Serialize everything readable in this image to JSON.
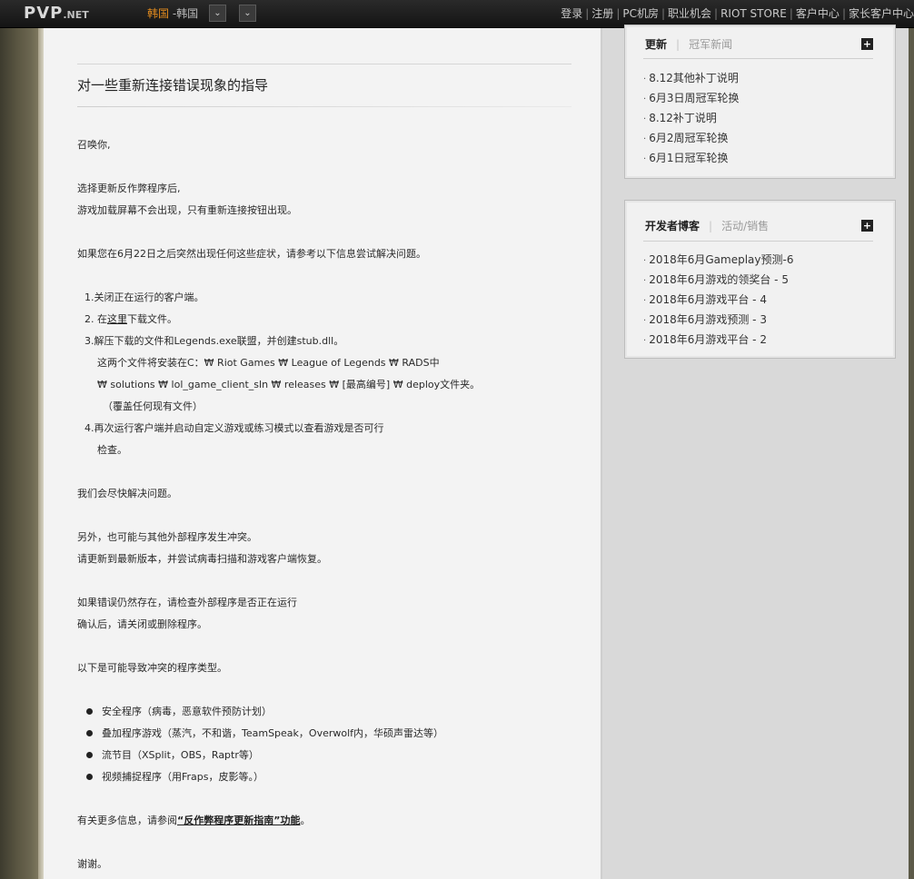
{
  "topbar": {
    "logo_main": "PVP",
    "logo_suffix": ".NET",
    "region_primary": "韩国",
    "region_secondary": "-韩国",
    "dropdown_glyph": "⌄",
    "nav": [
      "登录",
      "注册",
      "PC机房",
      "职业机会",
      "RIOT STORE",
      "客户中心",
      "家长客户中心"
    ],
    "nav_separator": "|"
  },
  "article": {
    "title": "对一些重新连接错误现象的指导",
    "lines": {
      "greeting": "召唤你,",
      "p1a": "选择更新反作弊程序后,",
      "p1b": "游戏加载屏幕不会出现，只有重新连接按钮出现。",
      "p2": "如果您在6月22日之后突然出现任何这些症状，请参考以下信息尝试解决问题。",
      "s1": "1.关闭正在运行的客户端。",
      "s2_pre": "2. 在",
      "s2_link": "这里",
      "s2_post": "下载文件。",
      "s3": "3.解压下载的文件和Legends.exe联盟，并创建stub.dll。",
      "s3b": "这两个文件将安装在C：₩ Riot Games ₩ League of Legends ₩ RADS中",
      "s3c": "₩ solutions ₩ lol_game_client_sln ₩ releases ₩ [最高编号] ₩ deploy文件夹。",
      "s3d": "（覆盖任何现有文件）",
      "s4": "4.再次运行客户端并启动自定义游戏或练习模式以查看游戏是否可行",
      "s4b": "检查。",
      "p3": "我们会尽快解决问题。",
      "p4a": "另外，也可能与其他外部程序发生冲突。",
      "p4b": "请更新到最新版本，并尝试病毒扫描和游戏客户端恢复。",
      "p5a": "如果错误仍然存在，请检查外部程序是否正在运行",
      "p5b": "确认后，请关闭或删除程序。",
      "p6": "以下是可能导致冲突的程序类型。",
      "b1": "安全程序（病毒，恶意软件预防计划）",
      "b2": "叠加程序游戏（蒸汽，不和谐，TeamSpeak，Overwolf内，华硕声雷达等）",
      "b3": "流节目（XSplit，OBS，Raptr等）",
      "b4": "视频捕捉程序（用Fraps，皮影等。）",
      "p7_pre": "有关更多信息，请参阅",
      "p7_link": "“反作弊程序更新指南”功能",
      "p7_post": "。",
      "thanks": "谢谢。"
    }
  },
  "sidebar": {
    "news_box": {
      "tab_active": "更新",
      "tab_inactive": "冠军新闻",
      "plus": "+",
      "items": [
        "8.12其他补丁说明",
        "6月3日周冠军轮换",
        "8.12补丁说明",
        "6月2周冠军轮换",
        "6月1日冠军轮换"
      ]
    },
    "dev_box": {
      "tab_active": "开发者博客",
      "tab_inactive": "活动/销售",
      "plus": "+",
      "items": [
        "2018年6月Gameplay预测-6",
        "2018年6月游戏的领奖台 - 5",
        "2018年6月游戏平台 - 4",
        "2018年6月游戏预测 - 3",
        "2018年6月游戏平台 - 2"
      ]
    },
    "bullet_glyph": "·"
  },
  "colors": {
    "region_accent": "#e08a1e",
    "content_bg": "#f3f3f3",
    "sidebar_bg": "#d9d9d9"
  }
}
